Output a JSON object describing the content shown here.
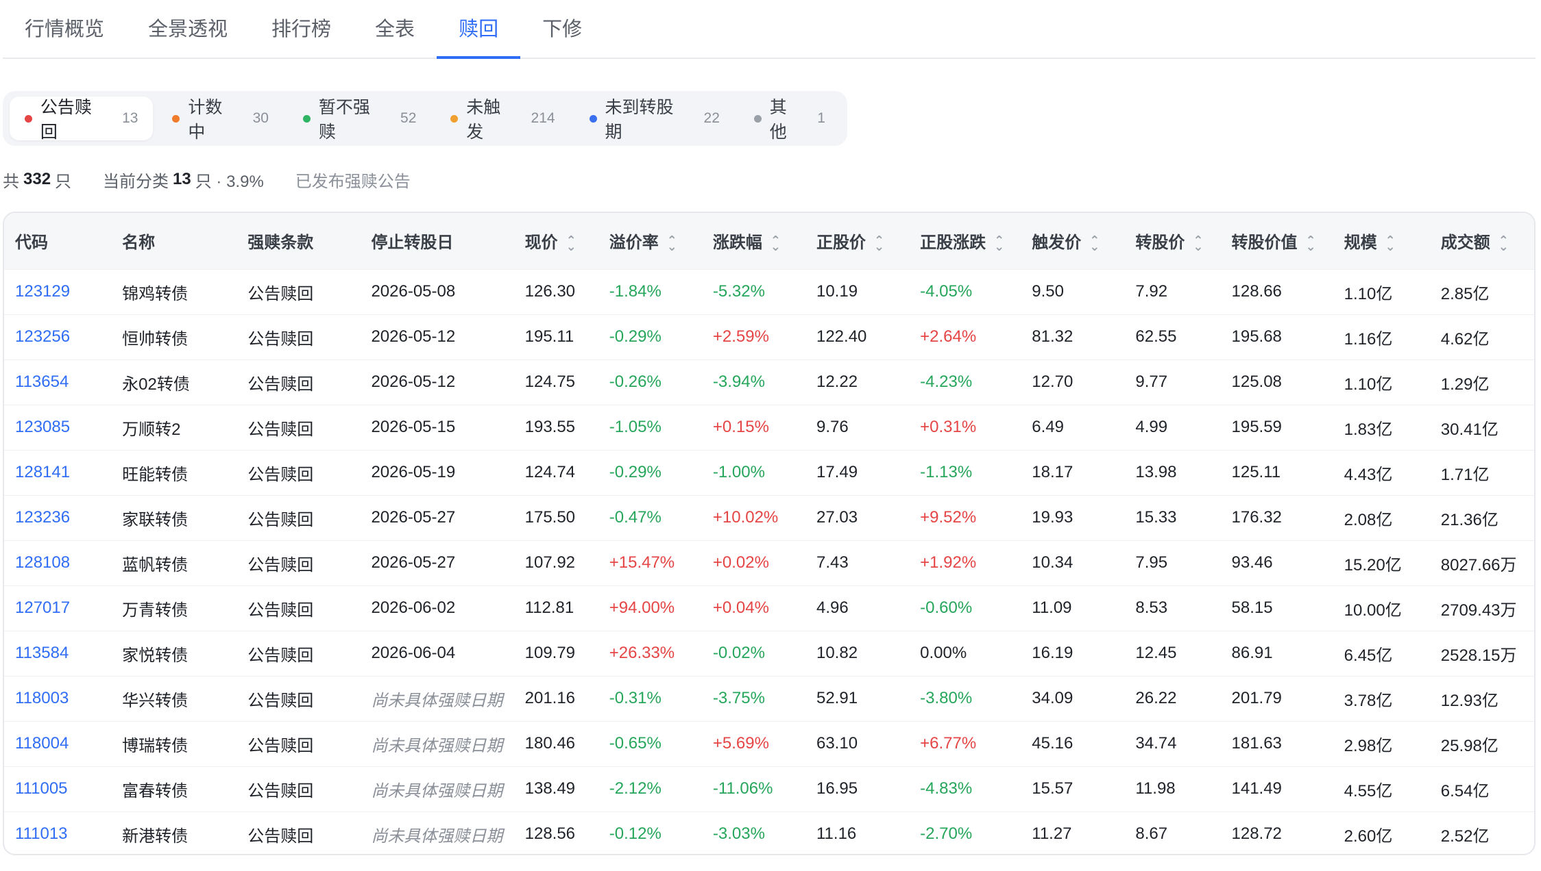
{
  "nav": {
    "tabs": [
      {
        "label": "行情概览",
        "active": false
      },
      {
        "label": "全景透视",
        "active": false
      },
      {
        "label": "排行榜",
        "active": false
      },
      {
        "label": "全表",
        "active": false
      },
      {
        "label": "赎回",
        "active": true
      },
      {
        "label": "下修",
        "active": false
      }
    ]
  },
  "filters": [
    {
      "label": "公告赎回",
      "count": "13",
      "color": "#e64545",
      "active": true
    },
    {
      "label": "计数中",
      "count": "30",
      "color": "#f07c2b",
      "active": false
    },
    {
      "label": "暂不强赎",
      "count": "52",
      "color": "#2fb463",
      "active": false
    },
    {
      "label": "未触发",
      "count": "214",
      "color": "#f0a030",
      "active": false
    },
    {
      "label": "未到转股期",
      "count": "22",
      "color": "#3a6ff0",
      "active": false
    },
    {
      "label": "其他",
      "count": "1",
      "color": "#9aa0a8",
      "active": false
    }
  ],
  "summary": {
    "total_prefix": "共",
    "total_count": "332",
    "total_suffix": "只",
    "current_prefix": "当前分类",
    "current_count": "13",
    "current_suffix": "只 · 3.9%",
    "note": "已发布强赎公告"
  },
  "table": {
    "columns": [
      {
        "label": "代码",
        "sortable": false
      },
      {
        "label": "名称",
        "sortable": false
      },
      {
        "label": "强赎条款",
        "sortable": false
      },
      {
        "label": "停止转股日",
        "sortable": false
      },
      {
        "label": "现价",
        "sortable": true
      },
      {
        "label": "溢价率",
        "sortable": true
      },
      {
        "label": "涨跌幅",
        "sortable": true
      },
      {
        "label": "正股价",
        "sortable": true
      },
      {
        "label": "正股涨跌",
        "sortable": true
      },
      {
        "label": "触发价",
        "sortable": true
      },
      {
        "label": "转股价",
        "sortable": true
      },
      {
        "label": "转股价值",
        "sortable": true
      },
      {
        "label": "规模",
        "sortable": true
      },
      {
        "label": "成交额",
        "sortable": true
      }
    ],
    "rows": [
      [
        "123129",
        "锦鸡转债",
        "公告赎回",
        "2026-05-08",
        "126.30",
        "-1.84%",
        "-5.32%",
        "10.19",
        "-4.05%",
        "9.50",
        "7.92",
        "128.66",
        "1.10亿",
        "2.85亿"
      ],
      [
        "123256",
        "恒帅转债",
        "公告赎回",
        "2026-05-12",
        "195.11",
        "-0.29%",
        "+2.59%",
        "122.40",
        "+2.64%",
        "81.32",
        "62.55",
        "195.68",
        "1.16亿",
        "4.62亿"
      ],
      [
        "113654",
        "永02转债",
        "公告赎回",
        "2026-05-12",
        "124.75",
        "-0.26%",
        "-3.94%",
        "12.22",
        "-4.23%",
        "12.70",
        "9.77",
        "125.08",
        "1.10亿",
        "1.29亿"
      ],
      [
        "123085",
        "万顺转2",
        "公告赎回",
        "2026-05-15",
        "193.55",
        "-1.05%",
        "+0.15%",
        "9.76",
        "+0.31%",
        "6.49",
        "4.99",
        "195.59",
        "1.83亿",
        "30.41亿"
      ],
      [
        "128141",
        "旺能转债",
        "公告赎回",
        "2026-05-19",
        "124.74",
        "-0.29%",
        "-1.00%",
        "17.49",
        "-1.13%",
        "18.17",
        "13.98",
        "125.11",
        "4.43亿",
        "1.71亿"
      ],
      [
        "123236",
        "家联转债",
        "公告赎回",
        "2026-05-27",
        "175.50",
        "-0.47%",
        "+10.02%",
        "27.03",
        "+9.52%",
        "19.93",
        "15.33",
        "176.32",
        "2.08亿",
        "21.36亿"
      ],
      [
        "128108",
        "蓝帆转债",
        "公告赎回",
        "2026-05-27",
        "107.92",
        "+15.47%",
        "+0.02%",
        "7.43",
        "+1.92%",
        "10.34",
        "7.95",
        "93.46",
        "15.20亿",
        "8027.66万"
      ],
      [
        "127017",
        "万青转债",
        "公告赎回",
        "2026-06-02",
        "112.81",
        "+94.00%",
        "+0.04%",
        "4.96",
        "-0.60%",
        "11.09",
        "8.53",
        "58.15",
        "10.00亿",
        "2709.43万"
      ],
      [
        "113584",
        "家悦转债",
        "公告赎回",
        "2026-06-04",
        "109.79",
        "+26.33%",
        "-0.02%",
        "10.82",
        "0.00%",
        "16.19",
        "12.45",
        "86.91",
        "6.45亿",
        "2528.15万"
      ],
      [
        "118003",
        "华兴转债",
        "公告赎回",
        "尚未具体强赎日期",
        "201.16",
        "-0.31%",
        "-3.75%",
        "52.91",
        "-3.80%",
        "34.09",
        "26.22",
        "201.79",
        "3.78亿",
        "12.93亿"
      ],
      [
        "118004",
        "博瑞转债",
        "公告赎回",
        "尚未具体强赎日期",
        "180.46",
        "-0.65%",
        "+5.69%",
        "63.10",
        "+6.77%",
        "45.16",
        "34.74",
        "181.63",
        "2.98亿",
        "25.98亿"
      ],
      [
        "111005",
        "富春转债",
        "公告赎回",
        "尚未具体强赎日期",
        "138.49",
        "-2.12%",
        "-11.06%",
        "16.95",
        "-4.83%",
        "15.57",
        "11.98",
        "141.49",
        "4.55亿",
        "6.54亿"
      ],
      [
        "111013",
        "新港转债",
        "公告赎回",
        "尚未具体强赎日期",
        "128.56",
        "-0.12%",
        "-3.03%",
        "11.16",
        "-2.70%",
        "11.27",
        "8.67",
        "128.72",
        "2.60亿",
        "2.52亿"
      ]
    ]
  },
  "colors": {
    "accent": "#2f6df6",
    "up": "#e64545",
    "down": "#26a65b",
    "muted": "#8a8f98"
  }
}
